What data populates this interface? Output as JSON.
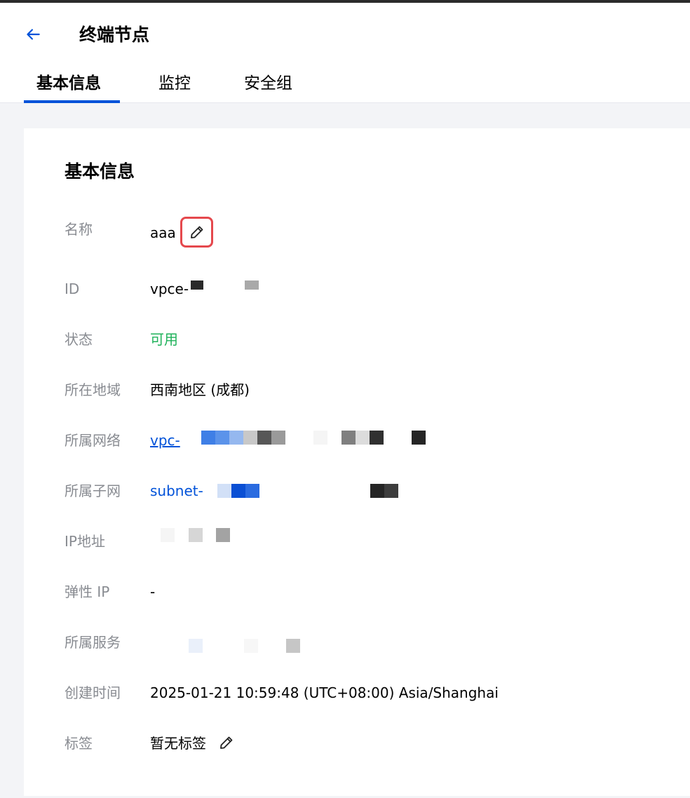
{
  "header": {
    "title": "终端节点",
    "back_icon": "arrow-left-icon"
  },
  "tabs": [
    {
      "label": "基本信息",
      "active": true
    },
    {
      "label": "监控",
      "active": false
    },
    {
      "label": "安全组",
      "active": false
    }
  ],
  "card": {
    "title": "基本信息",
    "rows": {
      "name": {
        "label": "名称",
        "value": "aaa"
      },
      "id": {
        "label": "ID",
        "value": "vpce-"
      },
      "status": {
        "label": "状态",
        "value": "可用"
      },
      "region": {
        "label": "所在地域",
        "value": "西南地区 (成都)"
      },
      "network": {
        "label": "所属网络",
        "value": "vpc-"
      },
      "subnet": {
        "label": "所属子网",
        "value": "subnet-"
      },
      "ip": {
        "label": "IP地址",
        "value": ""
      },
      "eip": {
        "label": "弹性 IP",
        "value": "-"
      },
      "service": {
        "label": "所属服务",
        "value": ""
      },
      "created": {
        "label": "创建时间",
        "value": "2025-01-21 10:59:48 (UTC+08:00) Asia/Shanghai"
      },
      "tags": {
        "label": "标签",
        "value": "暂无标签"
      }
    }
  },
  "colors": {
    "accent": "#0052d9",
    "status_green": "#1fb25a",
    "highlight_red": "#e5484d",
    "label_gray": "#888b91"
  }
}
